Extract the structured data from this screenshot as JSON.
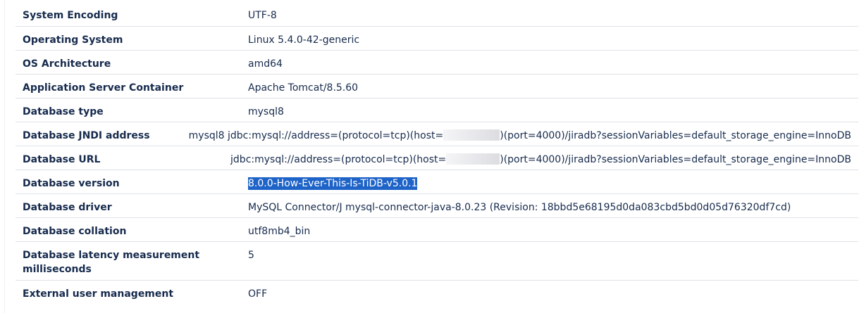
{
  "rows": [
    {
      "key": "System Encoding",
      "value": "UTF-8"
    },
    {
      "key": "Operating System",
      "value": "Linux 5.4.0-42-generic"
    },
    {
      "key": "OS Architecture",
      "value": "amd64"
    },
    {
      "key": "Application Server Container",
      "value": "Apache Tomcat/8.5.60"
    },
    {
      "key": "Database type",
      "value": "mysql8"
    },
    {
      "key": "Database JNDI address",
      "value_prefix": "mysql8 jdbc:mysql://address=(protocol=tcp)(host=",
      "value_suffix": ")(port=4000)/jiradb?sessionVariables=default_storage_engine=InnoDB"
    },
    {
      "key": "Database URL",
      "value_prefix": "jdbc:mysql://address=(protocol=tcp)(host=",
      "value_suffix": ")(port=4000)/jiradb?sessionVariables=default_storage_engine=InnoDB"
    },
    {
      "key": "Database version",
      "value": "8.0.0-How-Ever-This-Is-TiDB-v5.0.1"
    },
    {
      "key": "Database driver",
      "value": "MySQL Connector/J mysql-connector-java-8.0.23 (Revision: 18bbd5e68195d0da083cbd5bd0d05d76320df7cd)"
    },
    {
      "key": "Database collation",
      "value": "utf8mb4_bin"
    },
    {
      "key": "Database latency measurement milliseconds",
      "value": "5"
    },
    {
      "key": "External user management",
      "value": "OFF"
    }
  ]
}
